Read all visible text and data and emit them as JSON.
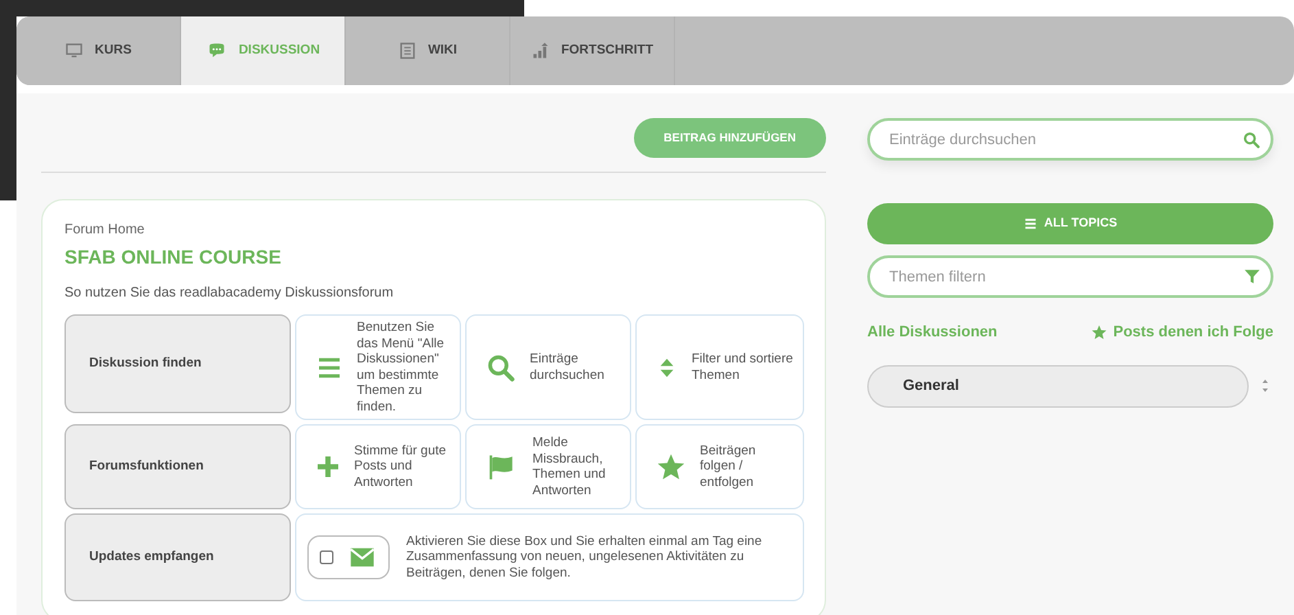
{
  "tabs": [
    {
      "label": "KURS",
      "selected": false
    },
    {
      "label": "DISKUSSION",
      "selected": true
    },
    {
      "label": "WIKI",
      "selected": false
    },
    {
      "label": "FORTSCHRITT",
      "selected": false
    }
  ],
  "add_post_button": "BEITRAG HINZUFÜGEN",
  "forum": {
    "breadcrumb": "Forum Home",
    "title": "SFAB ONLINE COURSE",
    "description": "So nutzen Sie das readlabacademy Diskussionsforum",
    "rows": [
      {
        "label": "Diskussion finden",
        "kind": "tips",
        "items": [
          "Benutzen Sie das Menü \"Alle Diskussionen\" um bestimmte Themen zu finden.",
          "Einträge durchsuchen",
          "Filter und sortiere Themen"
        ]
      },
      {
        "label": "Forumsfunktionen",
        "kind": "tips",
        "items": [
          "Stimme für gute Posts und Antworten",
          "Melde Missbrauch, Themen und Antworten",
          "Beiträgen folgen / entfolgen"
        ]
      },
      {
        "label": "Updates empfangen",
        "kind": "subscribe",
        "checked": false,
        "text": "Aktivieren Sie diese Box und Sie erhalten einmal am Tag eine Zusammenfassung von neuen, ungelesenen Aktivitäten zu Beiträgen, denen Sie folgen."
      }
    ]
  },
  "sidebar": {
    "search": {
      "placeholder": "Einträge durchsuchen"
    },
    "all_topics_button": "ALL TOPICS",
    "filter": {
      "placeholder": "Themen filtern"
    },
    "links": [
      {
        "label": "Alle Diskussionen",
        "kind": "plain"
      },
      {
        "label": "Posts denen ich Folge",
        "kind": "star"
      }
    ],
    "topics": [
      {
        "label": "General"
      }
    ]
  }
}
